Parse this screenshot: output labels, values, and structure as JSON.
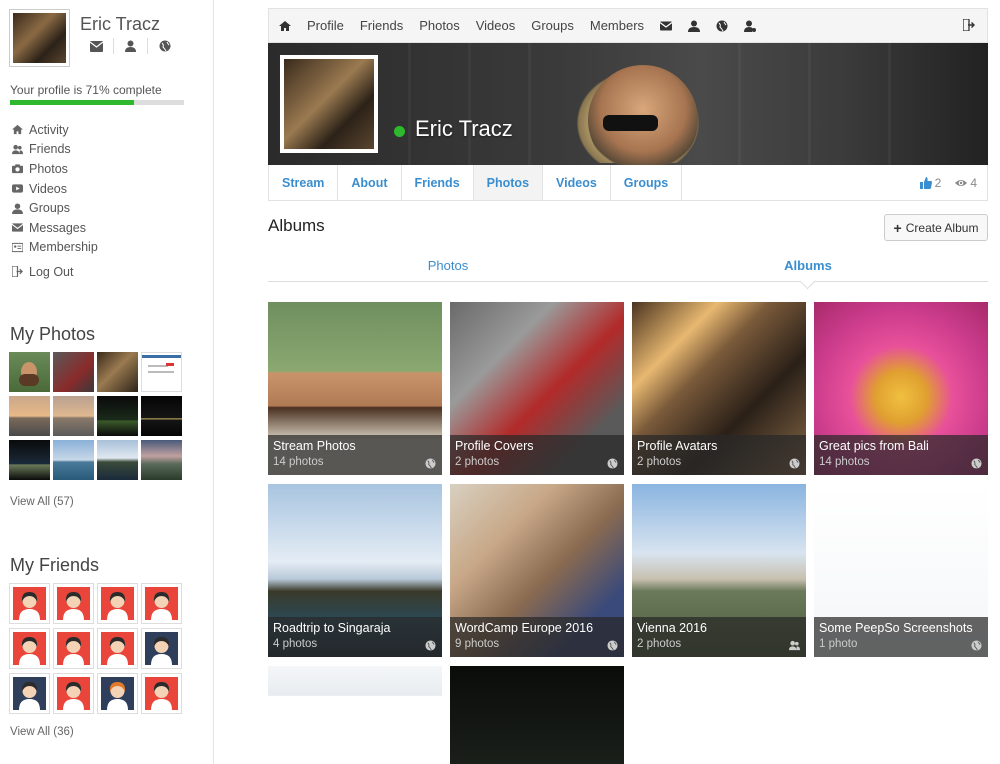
{
  "profile": {
    "name": "Eric Tracz",
    "complete_text": "Your profile is 71% complete",
    "complete_fraction": 0.71
  },
  "menu": {
    "items": [
      "Activity",
      "Friends",
      "Photos",
      "Videos",
      "Groups",
      "Messages",
      "Membership"
    ],
    "logout": "Log Out"
  },
  "my_photos": {
    "title": "My Photos",
    "view_all": "View All (57)"
  },
  "my_friends": {
    "title": "My Friends",
    "view_all": "View All (36)"
  },
  "topnav": {
    "items": [
      "Profile",
      "Friends",
      "Photos",
      "Videos",
      "Groups",
      "Members"
    ]
  },
  "cover": {
    "name": "Eric Tracz"
  },
  "tabs": {
    "items": [
      "Stream",
      "About",
      "Friends",
      "Photos",
      "Videos",
      "Groups"
    ],
    "active": "Photos",
    "likes": "2",
    "views": "4"
  },
  "albums_section": {
    "title": "Albums",
    "create_label": "Create Album"
  },
  "subtabs": {
    "photos": "Photos",
    "albums": "Albums"
  },
  "albums": [
    {
      "title": "Stream Photos",
      "count": "14 photos",
      "privacy": "globe-icon"
    },
    {
      "title": "Profile Covers",
      "count": "2 photos",
      "privacy": "globe-icon"
    },
    {
      "title": "Profile Avatars",
      "count": "2 photos",
      "privacy": "globe-icon"
    },
    {
      "title": "Great pics from Bali",
      "count": "14 photos",
      "privacy": "globe-icon"
    },
    {
      "title": "Roadtrip to Singaraja",
      "count": "4 photos",
      "privacy": "globe-icon"
    },
    {
      "title": "WordCamp Europe 2016",
      "count": "9 photos",
      "privacy": "globe-icon"
    },
    {
      "title": "Vienna 2016",
      "count": "2 photos",
      "privacy": "friends-icon"
    },
    {
      "title": "Some PeepSo Screenshots",
      "count": "1 photo",
      "privacy": "globe-icon"
    }
  ],
  "colors": {
    "accent": "#3a8ecf",
    "online": "#2eb82e",
    "progress": "#2eb82e",
    "friend_avatar_red": "#e9453a",
    "friend_avatar_navy": "#2f3e5a"
  }
}
